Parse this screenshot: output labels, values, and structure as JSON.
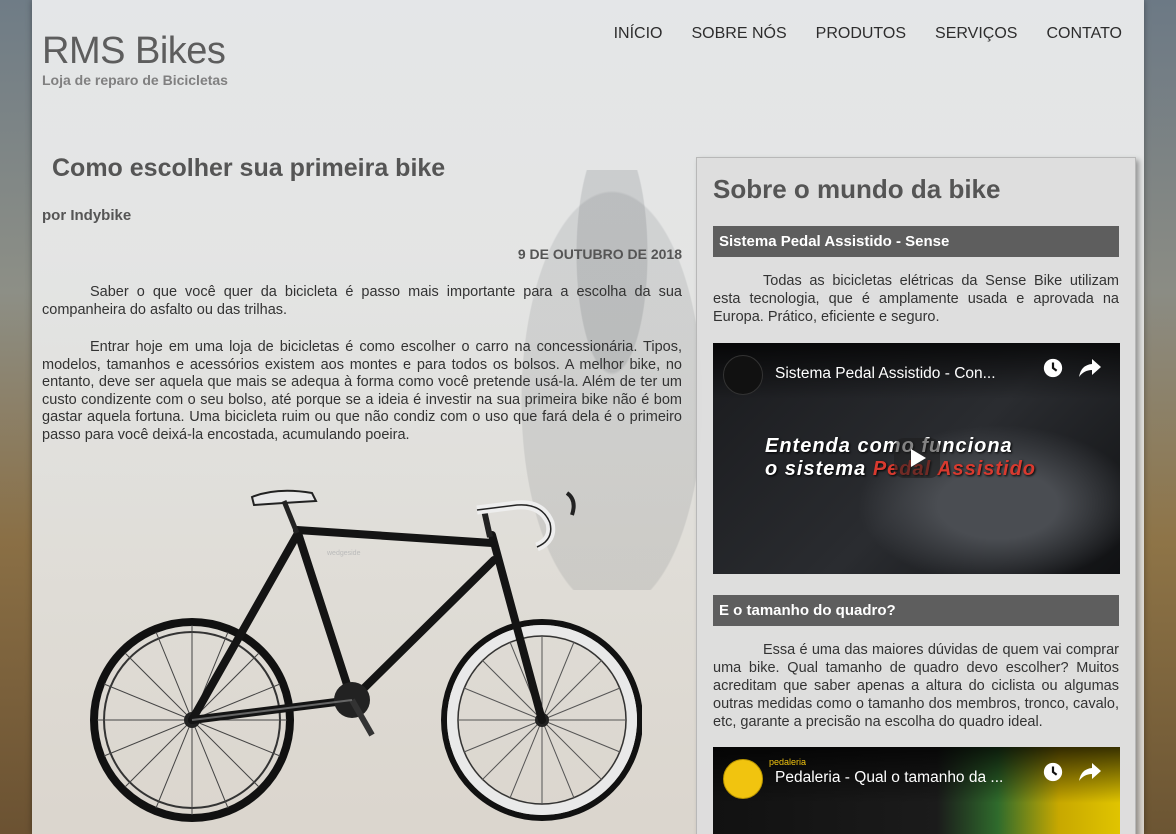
{
  "brand": {
    "title": "RMS Bikes",
    "subtitle": "Loja de reparo de Bicicletas"
  },
  "nav": {
    "items": [
      "INÍCIO",
      "SOBRE NÓS",
      "PRODUTOS",
      "SERVIÇOS",
      "CONTATO"
    ]
  },
  "article": {
    "title": "Como escolher sua primeira bike",
    "author": "por Indybike",
    "date": "9 DE OUTUBRO DE 2018",
    "paragraphs": [
      "Saber o que você quer da bicicleta é passo mais importante para a escolha da sua companheira do asfalto ou das trilhas.",
      "Entrar hoje em uma loja de bicicletas é como escolher o carro na concessionária. Tipos, modelos, tamanhos e acessórios existem aos montes e para todos os bolsos. A melhor bike, no entanto, deve ser aquela que mais se adequa à forma como você pretende usá-la. Além de ter um custo condizente com o seu bolso, até porque se a ideia é investir na sua primeira bike não é bom gastar aquela fortuna. Uma bicicleta ruim ou que não condiz com o uso que fará dela é o primeiro passo para você deixá-la encostada, acumulando poeira."
    ],
    "image_frame_label": "wedgeside"
  },
  "sidebar": {
    "title": "Sobre o mundo da bike",
    "sections": [
      {
        "heading": "Sistema Pedal Assistido - Sense",
        "text": "Todas as bicicletas elétricas da Sense Bike utilizam esta tecnologia, que é amplamente usada e aprovada na Europa. Prático, eficiente e seguro.",
        "video_title": "Sistema Pedal Assistido - Con...",
        "video_overlay_line1": "Entenda como funciona",
        "video_overlay_line2a": "o sistema ",
        "video_overlay_line2b": "Pedal Assistido"
      },
      {
        "heading": "E o tamanho do quadro?",
        "text": "Essa é uma das maiores dúvidas de quem vai comprar uma bike. Qual tamanho de quadro devo escolher? Muitos acreditam que saber apenas a altura do ciclista ou algumas outras medidas como o tamanho dos membros, tronco, cavalo, etc, garante a precisão na escolha do quadro ideal.",
        "video_title": "Pedaleria - Qual o tamanho da ...",
        "video_channel": "pedaleria"
      }
    ]
  },
  "colors": {
    "heading_bar": "#5e5e5e",
    "text": "#333333",
    "accent_red": "#d83a2f"
  }
}
